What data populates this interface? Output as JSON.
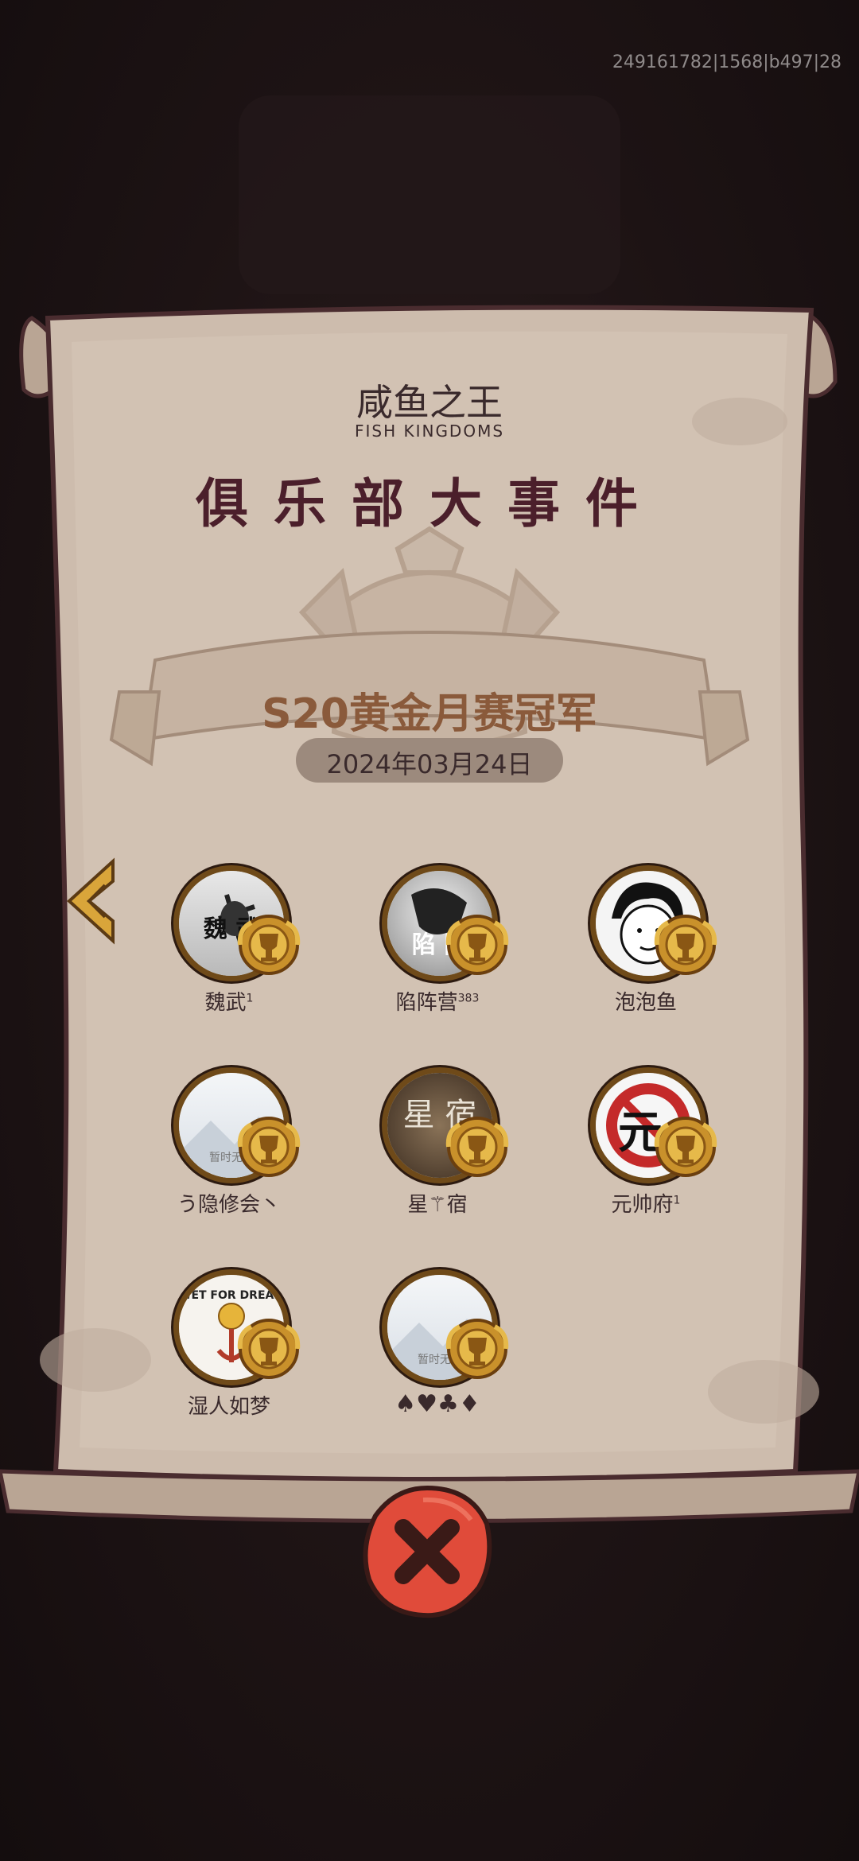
{
  "debug_text": "249161782|1568|b497|28",
  "header": {
    "game_title": "咸鱼之王",
    "game_title_en": "FISH KINGDOMS",
    "event_title": "俱乐部大事件"
  },
  "banner": {
    "achievement": "S20黄金月赛冠军",
    "date": "2024年03月24日"
  },
  "clubs": [
    {
      "name": "魏武",
      "sup": "1",
      "avatar_text": "魏 武"
    },
    {
      "name": "陷阵营",
      "sup": "383",
      "avatar_text": "陷 阵"
    },
    {
      "name": "泡泡鱼",
      "sup": "",
      "avatar_text": ""
    },
    {
      "name": "う隐修会丶",
      "sup": "",
      "avatar_text": "暂时无法"
    },
    {
      "name": "星⚚宿",
      "sup": "",
      "avatar_text": "星 宿"
    },
    {
      "name": "元帅府",
      "sup": "1",
      "avatar_text": "元"
    },
    {
      "name": "湿人如梦",
      "sup": "",
      "avatar_text": "WET FOR DREAM"
    },
    {
      "name": "♠♥♣♦",
      "sup": "",
      "avatar_text": "暂时无法"
    }
  ],
  "icons": {
    "back": "chevron-left-icon",
    "close": "close-x-icon",
    "badge": "gold-trophy-badge-icon"
  },
  "colors": {
    "parchment": "#cdbcad",
    "title": "#4b1f2b",
    "banner_text": "#8a5a3b",
    "close_button": "#e04b3a",
    "gold": "#d9a53a"
  }
}
